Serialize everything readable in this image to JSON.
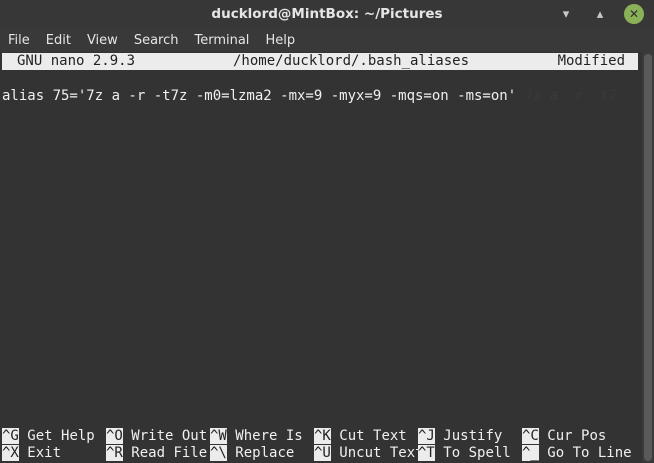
{
  "window": {
    "title": "ducklord@MintBox: ~/Pictures"
  },
  "menu": [
    "File",
    "Edit",
    "View",
    "Search",
    "Terminal",
    "Help"
  ],
  "nano": {
    "version": "GNU nano 2.9.3",
    "file": "/home/ducklord/.bash_aliases",
    "status": "Modified"
  },
  "content": {
    "line1": "alias 75='7z a -r -t7z -m0=lzma2 -mx=9 -myx=9 -mqs=on -ms=on'",
    "ghost": "7z a -r -t7"
  },
  "shortcuts": [
    {
      "key": "^G",
      "label": "Get Help"
    },
    {
      "key": "^O",
      "label": "Write Out"
    },
    {
      "key": "^W",
      "label": "Where Is"
    },
    {
      "key": "^K",
      "label": "Cut Text"
    },
    {
      "key": "^J",
      "label": "Justify"
    },
    {
      "key": "^C",
      "label": "Cur Pos"
    },
    {
      "key": "^X",
      "label": "Exit"
    },
    {
      "key": "^R",
      "label": "Read File"
    },
    {
      "key": "^\\",
      "label": "Replace"
    },
    {
      "key": "^U",
      "label": "Uncut Text"
    },
    {
      "key": "^T",
      "label": "To Spell"
    },
    {
      "key": "^_",
      "label": "Go To Line"
    }
  ]
}
